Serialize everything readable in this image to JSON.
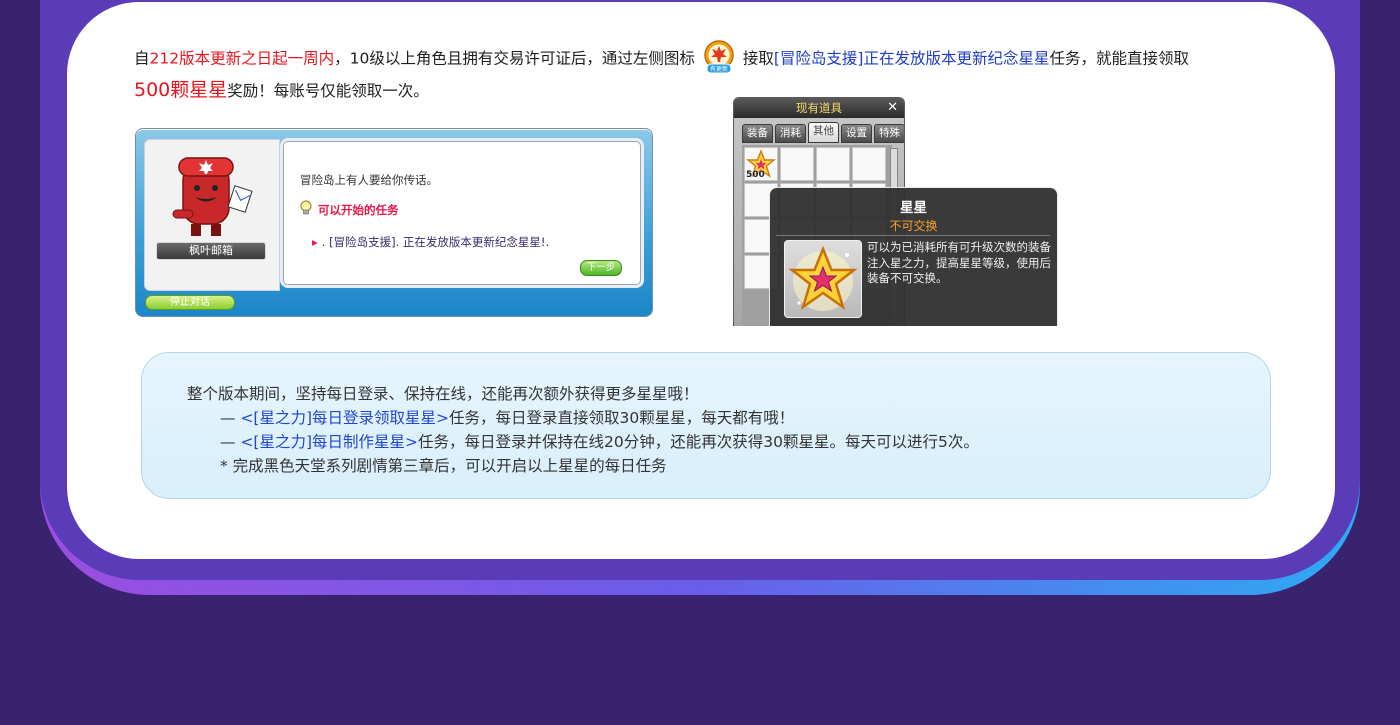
{
  "intro": {
    "p1_a": "自",
    "p1_red": "212版本更新之日起一周内",
    "p1_b": "，10级以上角色且拥有交易许可证后，通过左侧图标",
    "p1_c": "接取",
    "p1_blue": "[冒险岛支援]正在发放版本更新纪念星星",
    "p1_d": "任务，就能直接领取",
    "p2_red": "500颗星星",
    "p2_b": "奖励！每账号仅能领取一次。",
    "badge_icon": "maple-leaf-badge-icon"
  },
  "npc_dialog": {
    "npc_name": "枫叶邮箱",
    "line1": "冒险岛上有人要给你传话。",
    "line2": "可以开始的任务",
    "line3": ". [冒险岛支援]. 正在发放版本更新纪念星星!.",
    "next_label": "下一步",
    "stop_label": "停止对话"
  },
  "inventory": {
    "title": "现有道具",
    "tabs": [
      "装备",
      "消耗",
      "其他",
      "设置",
      "特殊"
    ],
    "active_tab": "其他",
    "first_slot_qty": "500"
  },
  "tooltip": {
    "name": "星星",
    "sub": "不可交换",
    "desc": "可以为已消耗所有可升级次数的装备注入星之力，提高星星等级，使用后装备不可交换。"
  },
  "info": {
    "line1": "整个版本期间，坚持每日登录、保持在线，还能再次额外获得更多星星哦！",
    "line2_dash": "—",
    "line2_blue": "<[星之力]每日登录领取星星>",
    "line2_rest": "任务，每日登录直接领取30颗星星，每天都有哦！",
    "line3_dash": "—",
    "line3_blue": "<[星之力]每日制作星星>",
    "line3_rest": "任务，每日登录并保持在线20分钟，还能再次获得30颗星星。每天可以进行5次。",
    "line4": "* 完成黑色天堂系列剧情第三章后，可以开启以上星星的每日任务"
  },
  "colors": {
    "background": "#3a236e",
    "panel": "#5a3bb8",
    "red_text": "#e8141d",
    "blue_text": "#1e3cc8"
  }
}
